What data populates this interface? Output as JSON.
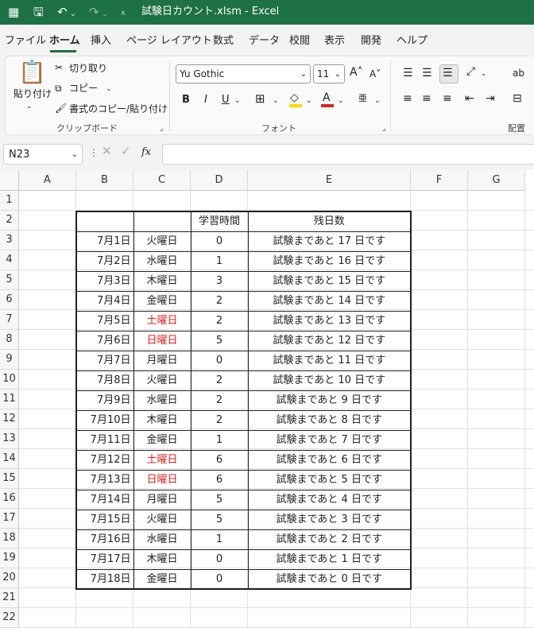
{
  "titlebar": {
    "title": "試験日カウント.xlsm  -  Excel",
    "icons": [
      "excel-app-icon",
      "save-icon",
      "undo-icon",
      "redo-icon",
      "customize-qat-icon"
    ]
  },
  "tabs": [
    {
      "label": "ファイル"
    },
    {
      "label": "ホーム",
      "active": true
    },
    {
      "label": "挿入"
    },
    {
      "label": "ページ レイアウト"
    },
    {
      "label": "数式"
    },
    {
      "label": "データ"
    },
    {
      "label": "校閲"
    },
    {
      "label": "表示"
    },
    {
      "label": "開発"
    },
    {
      "label": "ヘルプ"
    }
  ],
  "ribbon": {
    "clipboard": {
      "paste": "貼り付け",
      "cut": "切り取り",
      "copy": "コピー",
      "format_painter": "書式のコピー/貼り付け",
      "group_label": "クリップボード"
    },
    "font": {
      "font_name": "Yu Gothic",
      "font_size": "11",
      "bold": "B",
      "italic": "I",
      "underline": "U",
      "group_label": "フォント"
    },
    "alignment": {
      "group_label": "配置"
    }
  },
  "formula_bar": {
    "name_box": "N23",
    "fx": "fx",
    "content": ""
  },
  "sheet": {
    "columns": [
      "A",
      "B",
      "C",
      "D",
      "E",
      "F",
      "G"
    ],
    "rows": [
      "1",
      "2",
      "3",
      "4",
      "5",
      "6",
      "7",
      "8",
      "9",
      "10",
      "11",
      "12",
      "13",
      "14",
      "15",
      "16",
      "17",
      "18",
      "19",
      "20",
      "21",
      "22"
    ],
    "header": {
      "b": "",
      "c": "",
      "d": "学習時間",
      "e": "残日数"
    },
    "data": [
      {
        "date": "7月1日",
        "day": "火曜日",
        "hours": "0",
        "remaining": "試験まであと 17 日です",
        "weekend": false
      },
      {
        "date": "7月2日",
        "day": "水曜日",
        "hours": "1",
        "remaining": "試験まであと 16 日です",
        "weekend": false
      },
      {
        "date": "7月3日",
        "day": "木曜日",
        "hours": "3",
        "remaining": "試験まであと 15 日です",
        "weekend": false
      },
      {
        "date": "7月4日",
        "day": "金曜日",
        "hours": "2",
        "remaining": "試験まであと 14 日です",
        "weekend": false
      },
      {
        "date": "7月5日",
        "day": "土曜日",
        "hours": "2",
        "remaining": "試験まであと 13 日です",
        "weekend": true
      },
      {
        "date": "7月6日",
        "day": "日曜日",
        "hours": "5",
        "remaining": "試験まであと 12 日です",
        "weekend": true
      },
      {
        "date": "7月7日",
        "day": "月曜日",
        "hours": "0",
        "remaining": "試験まであと 11 日です",
        "weekend": false
      },
      {
        "date": "7月8日",
        "day": "火曜日",
        "hours": "2",
        "remaining": "試験まであと 10 日です",
        "weekend": false
      },
      {
        "date": "7月9日",
        "day": "水曜日",
        "hours": "2",
        "remaining": "試験まであと 9 日です",
        "weekend": false
      },
      {
        "date": "7月10日",
        "day": "木曜日",
        "hours": "2",
        "remaining": "試験まであと 8 日です",
        "weekend": false
      },
      {
        "date": "7月11日",
        "day": "金曜日",
        "hours": "1",
        "remaining": "試験まであと 7 日です",
        "weekend": false
      },
      {
        "date": "7月12日",
        "day": "土曜日",
        "hours": "6",
        "remaining": "試験まであと 6 日です",
        "weekend": true
      },
      {
        "date": "7月13日",
        "day": "日曜日",
        "hours": "6",
        "remaining": "試験まであと 5 日です",
        "weekend": true
      },
      {
        "date": "7月14日",
        "day": "月曜日",
        "hours": "5",
        "remaining": "試験まであと 4 日です",
        "weekend": false
      },
      {
        "date": "7月15日",
        "day": "火曜日",
        "hours": "5",
        "remaining": "試験まであと 3 日です",
        "weekend": false
      },
      {
        "date": "7月16日",
        "day": "水曜日",
        "hours": "1",
        "remaining": "試験まであと 2 日です",
        "weekend": false
      },
      {
        "date": "7月17日",
        "day": "木曜日",
        "hours": "0",
        "remaining": "試験まであと 1 日です",
        "weekend": false
      },
      {
        "date": "7月18日",
        "day": "金曜日",
        "hours": "0",
        "remaining": "試験まであと 0 日です",
        "weekend": false
      }
    ]
  },
  "colors": {
    "excel_green": "#1e7145",
    "weekend_red": "#e02020"
  }
}
